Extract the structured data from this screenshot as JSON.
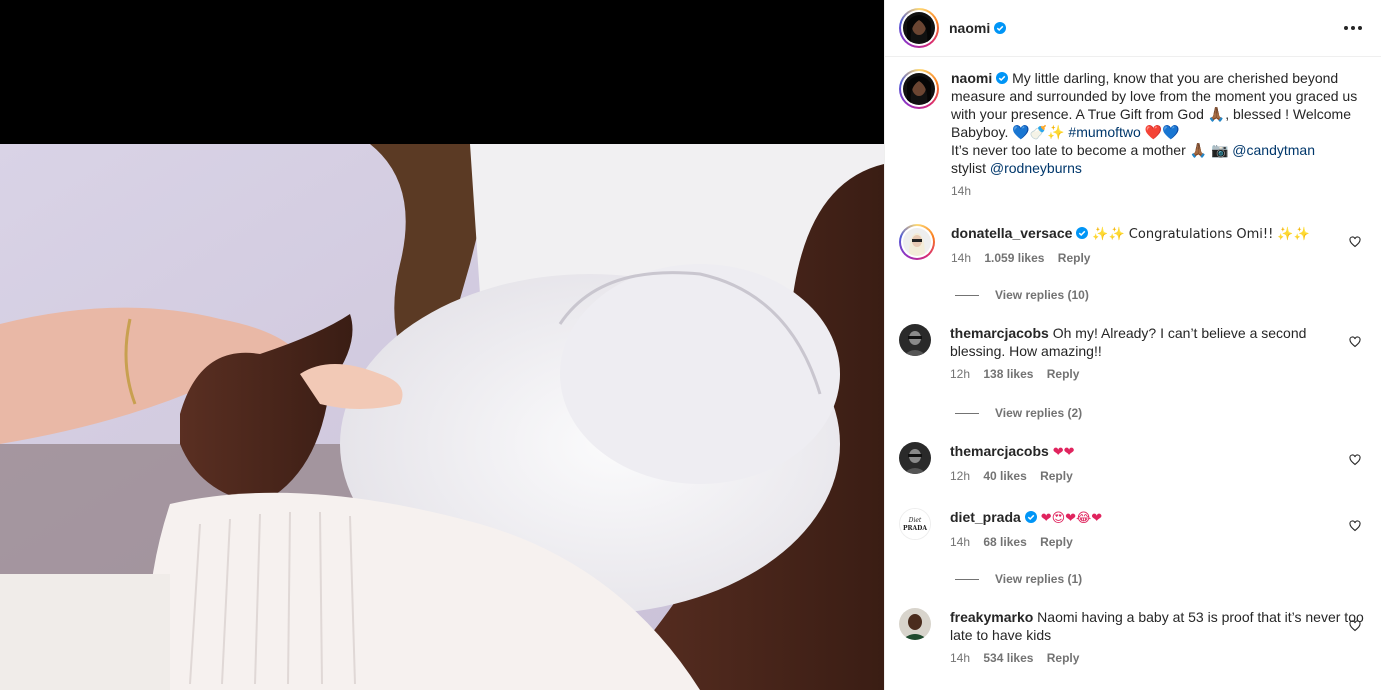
{
  "post": {
    "author": "naomi",
    "caption_text": "My little darling, know that you are cherished beyond measure and surrounded by love from the moment you graced us with your presence. A True Gift from God 🙏🏾, blessed ! Welcome Babyboy. 💙🍼✨",
    "caption_hashtag": "#mumoftwo",
    "caption_emoji_after": "❤️💙",
    "caption_line2": "It’s never too late to become a mother 🙏🏾 📷",
    "caption_mention1": "@candytman",
    "caption_line3": "stylist",
    "caption_mention2": "@rodneyburns",
    "time": "14h"
  },
  "comments": [
    {
      "user": "donatella_versace",
      "verified": true,
      "text": "✨✨ Congratulations Omi!! ✨✨",
      "time": "14h",
      "likes": "1.059 likes",
      "reply": "Reply",
      "view_replies": "View replies (10)"
    },
    {
      "user": "themarcjacobs",
      "verified": false,
      "text": "Oh my! Already? I can’t believe a second blessing. How amazing!!",
      "time": "12h",
      "likes": "138 likes",
      "reply": "Reply",
      "view_replies": "View replies (2)"
    },
    {
      "user": "themarcjacobs",
      "verified": false,
      "text": "❤❤",
      "time": "12h",
      "likes": "40 likes",
      "reply": "Reply"
    },
    {
      "user": "diet_prada",
      "verified": true,
      "text": "❤😍❤😂❤",
      "time": "14h",
      "likes": "68 likes",
      "reply": "Reply",
      "view_replies": "View replies (1)"
    },
    {
      "user": "freakymarko",
      "verified": false,
      "text": "Naomi having a baby at 53 is proof that it’s never too late to have kids",
      "time": "14h",
      "likes": "534 likes",
      "reply": "Reply"
    }
  ],
  "colors": {
    "verified": "#0095f6",
    "link": "#00376b",
    "meta": "#737373"
  }
}
